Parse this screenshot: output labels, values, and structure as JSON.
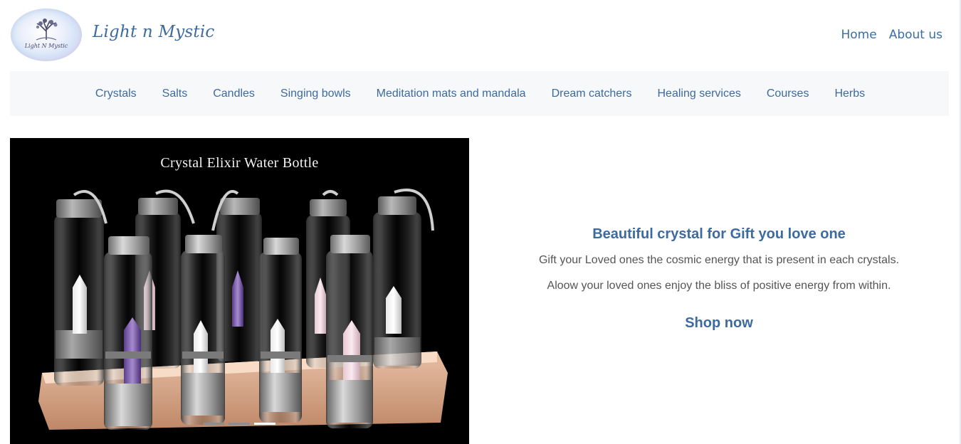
{
  "brand": {
    "name": "Light n Mystic",
    "logo_text": "Light N Mystic"
  },
  "top_nav": [
    {
      "label": "Home"
    },
    {
      "label": "About us"
    }
  ],
  "categories": [
    {
      "label": "Crystals"
    },
    {
      "label": "Salts"
    },
    {
      "label": "Candles"
    },
    {
      "label": "Singing bowls"
    },
    {
      "label": "Meditation mats and mandala"
    },
    {
      "label": "Dream catchers"
    },
    {
      "label": "Healing services"
    },
    {
      "label": "Courses"
    },
    {
      "label": "Herbs"
    }
  ],
  "hero": {
    "image_title": "Crystal Elixir Water Bottle",
    "slides_total": 3,
    "active_slide": 3
  },
  "promo": {
    "heading": "Beautiful crystal for Gift you love one",
    "line1": "Gift your Loved ones the cosmic energy that is present in each crystals.",
    "line2": "Aloow your loved ones enjoy the bliss of positive energy from within.",
    "cta": "Shop now"
  },
  "colors": {
    "accent": "#3d6a9f",
    "category_bar_bg": "#f7f8fa",
    "body_text": "#555555"
  }
}
